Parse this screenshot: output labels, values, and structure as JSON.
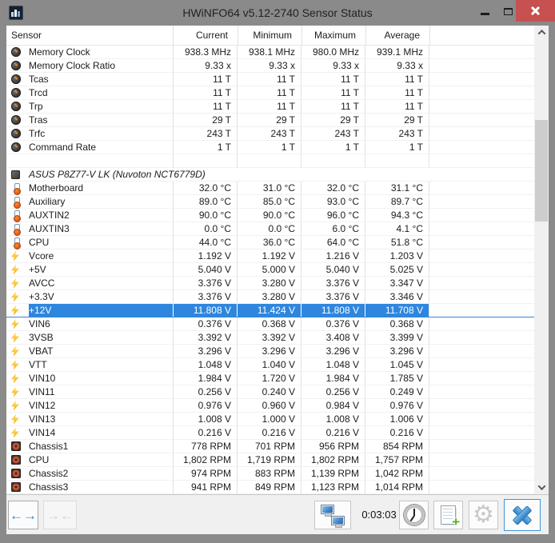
{
  "window": {
    "title": "HWiNFO64 v5.12-2740 Sensor Status",
    "controls": {
      "minimize": "minimize",
      "maximize": "maximize",
      "close": "close"
    },
    "app_icon": "hwinfo-bar-chart-icon"
  },
  "colors": {
    "titlebar": "#8a8a8a",
    "close_button_red": "#c75050",
    "selection_blue": "#2f86de",
    "toolbar_bg": "#f0f0f0",
    "table_bg": "#ffffff"
  },
  "table": {
    "columns": [
      "Sensor",
      "Current",
      "Minimum",
      "Maximum",
      "Average"
    ],
    "rows": [
      {
        "type": "data",
        "icon": "gauge",
        "label": "Memory Clock",
        "values": [
          "938.3 MHz",
          "938.1 MHz",
          "980.0 MHz",
          "939.1 MHz"
        ]
      },
      {
        "type": "data",
        "icon": "gauge",
        "label": "Memory Clock Ratio",
        "values": [
          "9.33 x",
          "9.33 x",
          "9.33 x",
          "9.33 x"
        ]
      },
      {
        "type": "data",
        "icon": "gauge",
        "label": "Tcas",
        "values": [
          "11 T",
          "11 T",
          "11 T",
          "11 T"
        ]
      },
      {
        "type": "data",
        "icon": "gauge",
        "label": "Trcd",
        "values": [
          "11 T",
          "11 T",
          "11 T",
          "11 T"
        ]
      },
      {
        "type": "data",
        "icon": "gauge",
        "label": "Trp",
        "values": [
          "11 T",
          "11 T",
          "11 T",
          "11 T"
        ]
      },
      {
        "type": "data",
        "icon": "gauge",
        "label": "Tras",
        "values": [
          "29 T",
          "29 T",
          "29 T",
          "29 T"
        ]
      },
      {
        "type": "data",
        "icon": "gauge",
        "label": "Trfc",
        "values": [
          "243 T",
          "243 T",
          "243 T",
          "243 T"
        ]
      },
      {
        "type": "data",
        "icon": "gauge",
        "label": "Command Rate",
        "values": [
          "1 T",
          "1 T",
          "1 T",
          "1 T"
        ]
      },
      {
        "type": "spacer",
        "icon": "",
        "label": "",
        "values": [
          "",
          "",
          "",
          ""
        ]
      },
      {
        "type": "section",
        "icon": "chip",
        "label": "ASUS P8Z77-V LK (Nuvoton NCT6779D)",
        "values": [
          "",
          "",
          "",
          ""
        ]
      },
      {
        "type": "data",
        "icon": "thermometer",
        "label": "Motherboard",
        "values": [
          "32.0 °C",
          "31.0 °C",
          "32.0 °C",
          "31.1 °C"
        ]
      },
      {
        "type": "data",
        "icon": "thermometer",
        "label": "Auxiliary",
        "values": [
          "89.0 °C",
          "85.0 °C",
          "93.0 °C",
          "89.7 °C"
        ]
      },
      {
        "type": "data",
        "icon": "thermometer",
        "label": "AUXTIN2",
        "values": [
          "90.0 °C",
          "90.0 °C",
          "96.0 °C",
          "94.3 °C"
        ]
      },
      {
        "type": "data",
        "icon": "thermometer",
        "label": "AUXTIN3",
        "values": [
          "0.0 °C",
          "0.0 °C",
          "6.0 °C",
          "4.1 °C"
        ]
      },
      {
        "type": "data",
        "icon": "thermometer",
        "label": "CPU",
        "values": [
          "44.0 °C",
          "36.0 °C",
          "64.0 °C",
          "51.8 °C"
        ]
      },
      {
        "type": "data",
        "icon": "bolt",
        "label": "Vcore",
        "values": [
          "1.192 V",
          "1.192 V",
          "1.216 V",
          "1.203 V"
        ]
      },
      {
        "type": "data",
        "icon": "bolt",
        "label": "+5V",
        "values": [
          "5.040 V",
          "5.000 V",
          "5.040 V",
          "5.025 V"
        ]
      },
      {
        "type": "data",
        "icon": "bolt",
        "label": "AVCC",
        "values": [
          "3.376 V",
          "3.280 V",
          "3.376 V",
          "3.347 V"
        ]
      },
      {
        "type": "data",
        "icon": "bolt",
        "label": "+3.3V",
        "values": [
          "3.376 V",
          "3.280 V",
          "3.376 V",
          "3.346 V"
        ]
      },
      {
        "type": "data",
        "icon": "bolt",
        "label": "+12V",
        "values": [
          "11.808 V",
          "11.424 V",
          "11.808 V",
          "11.708 V"
        ],
        "selected": true
      },
      {
        "type": "data",
        "icon": "bolt",
        "label": "VIN6",
        "values": [
          "0.376 V",
          "0.368 V",
          "0.376 V",
          "0.368 V"
        ]
      },
      {
        "type": "data",
        "icon": "bolt",
        "label": "3VSB",
        "values": [
          "3.392 V",
          "3.392 V",
          "3.408 V",
          "3.399 V"
        ]
      },
      {
        "type": "data",
        "icon": "bolt",
        "label": "VBAT",
        "values": [
          "3.296 V",
          "3.296 V",
          "3.296 V",
          "3.296 V"
        ]
      },
      {
        "type": "data",
        "icon": "bolt",
        "label": "VTT",
        "values": [
          "1.048 V",
          "1.040 V",
          "1.048 V",
          "1.045 V"
        ]
      },
      {
        "type": "data",
        "icon": "bolt",
        "label": "VIN10",
        "values": [
          "1.984 V",
          "1.720 V",
          "1.984 V",
          "1.785 V"
        ]
      },
      {
        "type": "data",
        "icon": "bolt",
        "label": "VIN11",
        "values": [
          "0.256 V",
          "0.240 V",
          "0.256 V",
          "0.249 V"
        ]
      },
      {
        "type": "data",
        "icon": "bolt",
        "label": "VIN12",
        "values": [
          "0.976 V",
          "0.960 V",
          "0.984 V",
          "0.976 V"
        ]
      },
      {
        "type": "data",
        "icon": "bolt",
        "label": "VIN13",
        "values": [
          "1.008 V",
          "1.000 V",
          "1.008 V",
          "1.006 V"
        ]
      },
      {
        "type": "data",
        "icon": "bolt",
        "label": "VIN14",
        "values": [
          "0.216 V",
          "0.216 V",
          "0.216 V",
          "0.216 V"
        ]
      },
      {
        "type": "data",
        "icon": "fan",
        "label": "Chassis1",
        "values": [
          "778 RPM",
          "701 RPM",
          "956 RPM",
          "854 RPM"
        ]
      },
      {
        "type": "data",
        "icon": "fan",
        "label": "CPU",
        "values": [
          "1,802 RPM",
          "1,719 RPM",
          "1,802 RPM",
          "1,757 RPM"
        ]
      },
      {
        "type": "data",
        "icon": "fan",
        "label": "Chassis2",
        "values": [
          "974 RPM",
          "883 RPM",
          "1,139 RPM",
          "1,042 RPM"
        ]
      },
      {
        "type": "data",
        "icon": "fan",
        "label": "Chassis3",
        "values": [
          "941 RPM",
          "849 RPM",
          "1,123 RPM",
          "1,014 RPM"
        ]
      }
    ]
  },
  "toolbar": {
    "elapsed_time": "0:03:03",
    "buttons": [
      {
        "name": "expand-columns",
        "icon": "arrows-out-icon",
        "enabled": true
      },
      {
        "name": "collapse-columns",
        "icon": "arrows-in-icon",
        "enabled": false
      },
      {
        "name": "remote-monitoring",
        "icon": "dual-monitors-icon",
        "enabled": true
      },
      {
        "name": "logging-clock",
        "icon": "clock-icon",
        "enabled": true
      },
      {
        "name": "add-report",
        "icon": "document-plus-icon",
        "enabled": true
      },
      {
        "name": "settings",
        "icon": "gear-icon",
        "enabled": false
      },
      {
        "name": "close-sensors",
        "icon": "blue-x-icon",
        "enabled": true
      }
    ]
  }
}
